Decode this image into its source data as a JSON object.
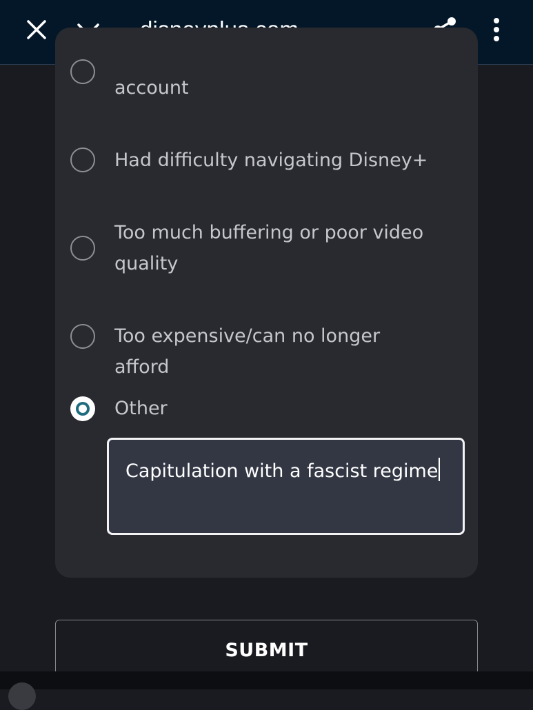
{
  "browser": {
    "url": "disneyplus.com",
    "icons": {
      "close": "close-icon",
      "collapse": "chevron-down-icon",
      "share": "share-icon",
      "menu": "more-vert-icon"
    },
    "bar_color": "#041729"
  },
  "survey": {
    "options": [
      {
        "label": "account",
        "selected": false
      },
      {
        "label": "Had difficulty navigating Disney+",
        "selected": false
      },
      {
        "label": "Too much buffering or poor video quality",
        "selected": false
      },
      {
        "label": "Too expensive/can no longer afford",
        "selected": false
      },
      {
        "label": "Other",
        "selected": true
      }
    ],
    "other_text": "Capitulation with a fascist regime",
    "accent_color": "#1e6c7e"
  },
  "submit_label": "SUBMIT"
}
